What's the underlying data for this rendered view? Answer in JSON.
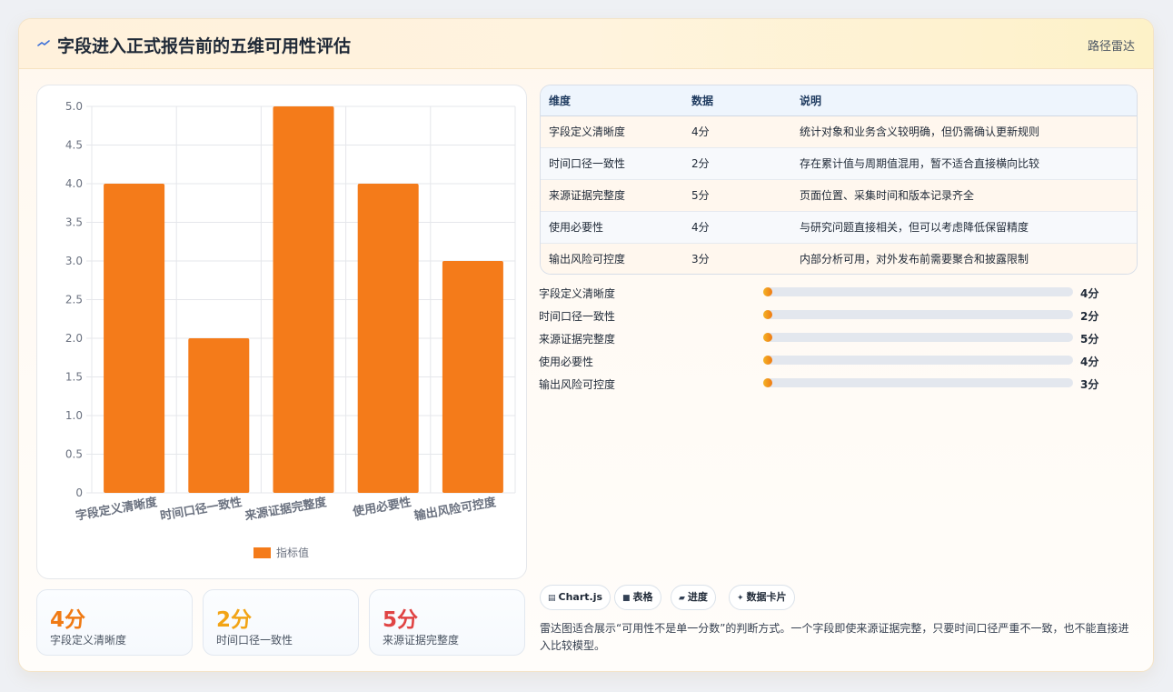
{
  "header": {
    "icon": "pulse-line-icon",
    "title": "字段进入正式报告前的五维可用性评估",
    "tag": "路径雷达"
  },
  "colors": {
    "bar": "#f47b1a",
    "accent_orange": "#f07a14",
    "accent_amber": "#f2a416",
    "accent_red": "#e04444"
  },
  "chart_data": {
    "type": "bar",
    "categories": [
      "字段定义清晰度",
      "时间口径一致性",
      "来源证据完整度",
      "使用必要性",
      "输出风险可控度"
    ],
    "series": [
      {
        "name": "指标值",
        "values": [
          4,
          2,
          5,
          4,
          3
        ]
      }
    ],
    "ylim": [
      0,
      5
    ],
    "yticks": [
      "0",
      "0.5",
      "1.0",
      "1.5",
      "2.0",
      "2.5",
      "3.0",
      "3.5",
      "4.0",
      "4.5",
      "5.0"
    ],
    "grid": true,
    "legend": "bottom"
  },
  "stats": [
    {
      "value": "4分",
      "label": "字段定义清晰度",
      "color": "#f07a14"
    },
    {
      "value": "2分",
      "label": "时间口径一致性",
      "color": "#f2a416"
    },
    {
      "value": "5分",
      "label": "来源证据完整度",
      "color": "#e04444"
    }
  ],
  "table": {
    "headers": [
      "维度",
      "数据",
      "说明"
    ],
    "rows": [
      [
        "字段定义清晰度",
        "4分",
        "统计对象和业务含义较明确，但仍需确认更新规则"
      ],
      [
        "时间口径一致性",
        "2分",
        "存在累计值与周期值混用，暂不适合直接横向比较"
      ],
      [
        "来源证据完整度",
        "5分",
        "页面位置、采集时间和版本记录齐全"
      ],
      [
        "使用必要性",
        "4分",
        "与研究问题直接相关，但可以考虑降低保留精度"
      ],
      [
        "输出风险可控度",
        "3分",
        "内部分析可用，对外发布前需要聚合和披露限制"
      ]
    ]
  },
  "progress": [
    {
      "label": "字段定义清晰度",
      "value": "4分",
      "fraction": 0.03
    },
    {
      "label": "时间口径一致性",
      "value": "2分",
      "fraction": 0.03
    },
    {
      "label": "来源证据完整度",
      "value": "5分",
      "fraction": 0.03
    },
    {
      "label": "使用必要性",
      "value": "4分",
      "fraction": 0.03
    },
    {
      "label": "输出风险可控度",
      "value": "3分",
      "fraction": 0.03
    }
  ],
  "chips": [
    {
      "icon": "chart-icon",
      "glyph": "▤",
      "label": "Chart.js"
    },
    {
      "icon": "table-icon",
      "glyph": "■",
      "label": "表格"
    },
    {
      "icon": "progress-icon",
      "glyph": "▰",
      "label": "进度"
    },
    {
      "icon": "sparkle-icon",
      "glyph": "✦",
      "label": "数据卡片"
    }
  ],
  "note": "雷达图适合展示“可用性不是单一分数”的判断方式。一个字段即使来源证据完整，只要时间口径严重不一致，也不能直接进入比较模型。"
}
